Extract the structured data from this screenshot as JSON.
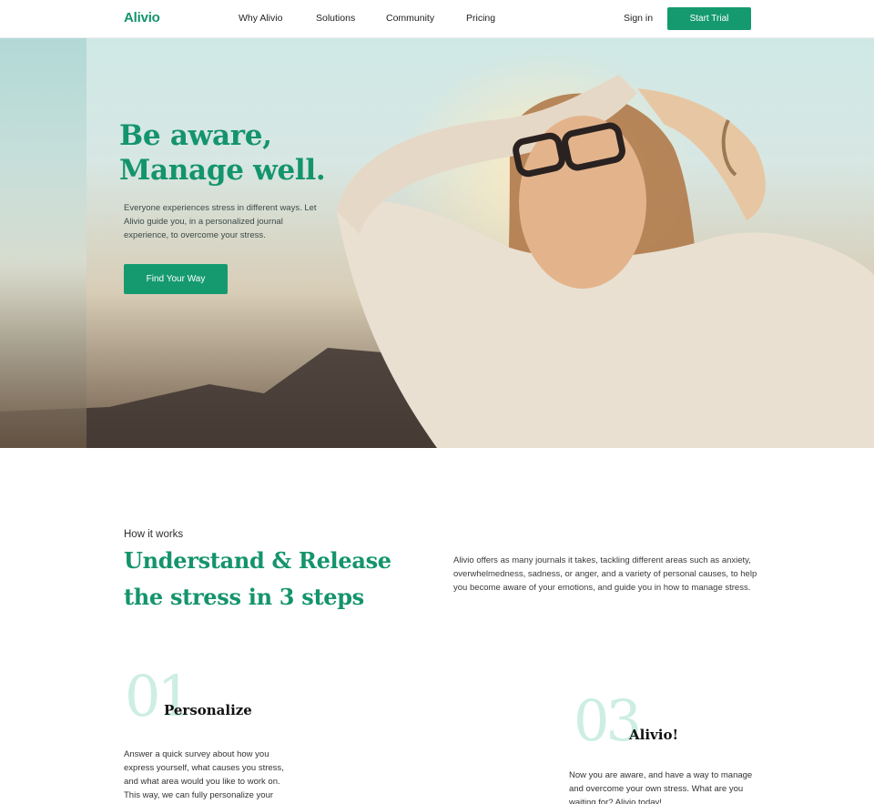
{
  "nav": {
    "logo": "Alivio",
    "links": [
      "Why Alivio",
      "Solutions",
      "Community",
      "Pricing"
    ],
    "signin": "Sign in",
    "cta": "Start Trial"
  },
  "hero": {
    "title_line1": "Be aware,",
    "title_line2": "Manage well.",
    "subtitle": "Everyone experiences stress in different ways. Let Alivio guide you, in a personalized journal experience, to overcome your stress.",
    "button": "Find Your Way"
  },
  "how": {
    "kicker": "How it works",
    "title_line1": "Understand & Release",
    "title_line2": "the stress in 3 steps",
    "description": "Alivio offers as many journals it takes, tackling different areas such as anxiety, overwhelmedness, sadness, or anger, and a variety of personal causes, to help you become aware of your emotions, and guide you in how to manage stress."
  },
  "steps": [
    {
      "number": "01",
      "title": "Personalize",
      "text": "Answer a quick survey about how you express yourself, what causes you stress, and what area would you like to work on. This way, we can fully personalize your"
    },
    {
      "number": "03",
      "title": "Alivio!",
      "text": "Now you are aware, and have a way to manage and overcome your own stress. What are you waiting for? Alivio today!"
    }
  ],
  "colors": {
    "brand": "#159a6f",
    "brand_text": "#14946c",
    "step_number": "#cdeee2"
  }
}
